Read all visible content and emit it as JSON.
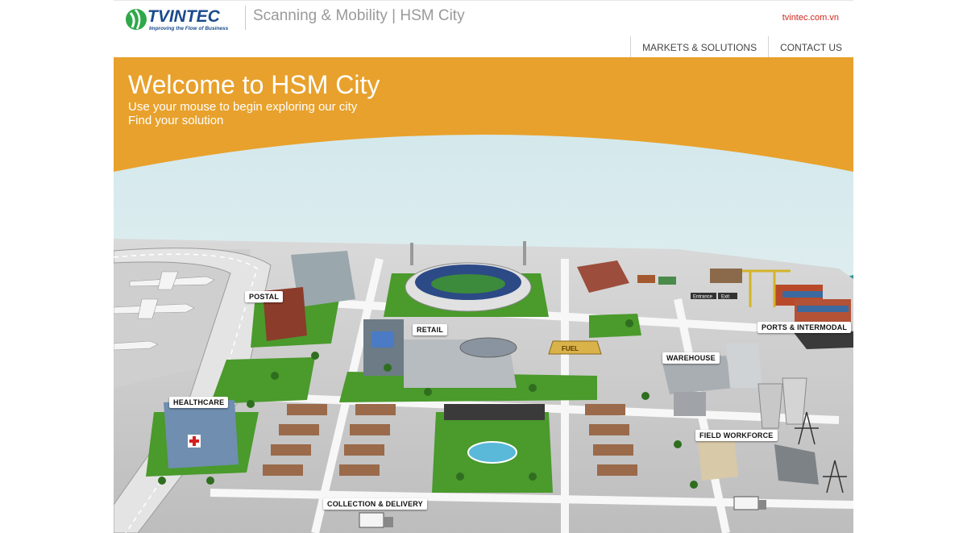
{
  "brand": {
    "logo_text": "TVINTEC",
    "logo_tagline": "Improving the Flow of Business",
    "site_title": "Scanning & Mobility | HSM City",
    "site_link": "tvintec.com.vn",
    "accent_color": "#e8a12c",
    "logo_blue": "#1a4a8c",
    "logo_green": "#2fa84a"
  },
  "nav": {
    "items": [
      {
        "label": "MARKETS & SOLUTIONS"
      },
      {
        "label": "CONTACT US"
      }
    ]
  },
  "hero": {
    "title": "Welcome to HSM City",
    "subtitle_1": "Use your mouse to begin exploring our city",
    "subtitle_2": "Find your solution"
  },
  "city": {
    "hotspots": [
      {
        "label": "POSTAL"
      },
      {
        "label": "RETAIL"
      },
      {
        "label": "PORTS & INTERMODAL"
      },
      {
        "label": "WAREHOUSE"
      },
      {
        "label": "HEALTHCARE"
      },
      {
        "label": "FIELD WORKFORCE"
      },
      {
        "label": "COLLECTION & DELIVERY"
      }
    ],
    "signs": {
      "fuel": "FUEL",
      "entrance": "Entrance",
      "exit": "Exit"
    }
  }
}
